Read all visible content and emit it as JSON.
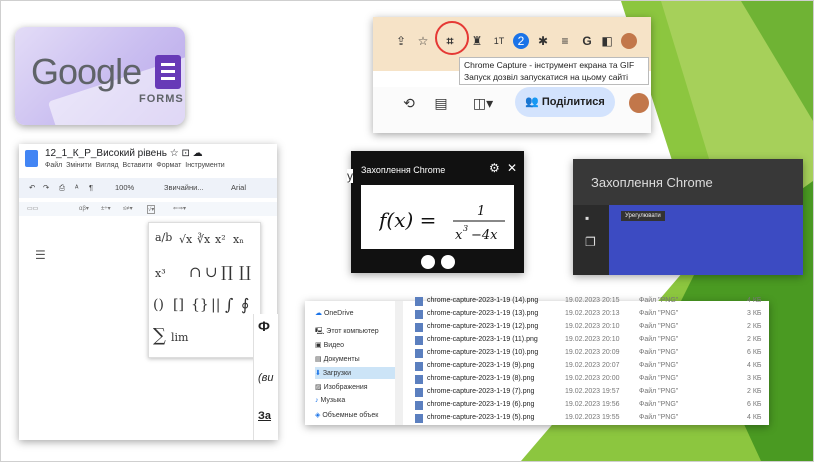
{
  "google_forms": {
    "word": "Google",
    "forms": "FORMS"
  },
  "browser": {
    "tooltip_line1": "Chrome Capture - інструмент екрана та GIF",
    "tooltip_line2": "Запуск дозвіл запускатися на цьому сайті",
    "share_label": "Поділитися"
  },
  "docs": {
    "title": "12_1_К_Р_Високий рівень",
    "menu": [
      "Файл",
      "Змінити",
      "Вигляд",
      "Вставити",
      "Формат",
      "Інструменти"
    ],
    "zoom": "100%",
    "style": "Звичайни...",
    "font": "Arial",
    "equations": [
      "a/b",
      "√x",
      "∛x",
      "x²",
      "xₙ",
      "x³",
      "∩",
      "∪",
      "∏",
      "∐",
      "()",
      "[]",
      "{}",
      "||",
      "∫",
      "∮",
      "∑",
      "lim"
    ],
    "side_text_1": "(ви",
    "side_text_2": "За"
  },
  "capture_popup": {
    "title": "Захоплення Chrome",
    "formula": "f(x) = 1 / (x³ − 4x)"
  },
  "capture_panel": {
    "title": "Захоплення Chrome",
    "tooltip": "Урегулювати"
  },
  "explorer": {
    "nav": [
      "OneDrive",
      "Этот компьютер",
      "Видео",
      "Документы",
      "Загрузки",
      "Изображения",
      "Музыка",
      "Объемные объек"
    ],
    "files": [
      {
        "name": "chrome-capture-2023-1-19 (14).png",
        "date": "19.02.2023 20:15",
        "type": "Файл \"PNG\"",
        "size": "4 КБ"
      },
      {
        "name": "chrome-capture-2023-1-19 (13).png",
        "date": "19.02.2023 20:13",
        "type": "Файл \"PNG\"",
        "size": "3 КБ"
      },
      {
        "name": "chrome-capture-2023-1-19 (12).png",
        "date": "19.02.2023 20:10",
        "type": "Файл \"PNG\"",
        "size": "2 КБ"
      },
      {
        "name": "chrome-capture-2023-1-19 (11).png",
        "date": "19.02.2023 20:10",
        "type": "Файл \"PNG\"",
        "size": "2 КБ"
      },
      {
        "name": "chrome-capture-2023-1-19 (10).png",
        "date": "19.02.2023 20:09",
        "type": "Файл \"PNG\"",
        "size": "6 КБ"
      },
      {
        "name": "chrome-capture-2023-1-19 (9).png",
        "date": "19.02.2023 20:07",
        "type": "Файл \"PNG\"",
        "size": "4 КБ"
      },
      {
        "name": "chrome-capture-2023-1-19 (8).png",
        "date": "19.02.2023 20:00",
        "type": "Файл \"PNG\"",
        "size": "3 КБ"
      },
      {
        "name": "chrome-capture-2023-1-19 (7).png",
        "date": "19.02.2023 19:57",
        "type": "Файл \"PNG\"",
        "size": "2 КБ"
      },
      {
        "name": "chrome-capture-2023-1-19 (6).png",
        "date": "19.02.2023 19:56",
        "type": "Файл \"PNG\"",
        "size": "6 КБ"
      },
      {
        "name": "chrome-capture-2023-1-19 (5).png",
        "date": "19.02.2023 19:55",
        "type": "Файл \"PNG\"",
        "size": "4 КБ"
      }
    ]
  },
  "colors": {
    "green_light": "#8cc63f",
    "green_dark": "#3f8f1d",
    "forms_purple": "#673ab7",
    "capture_blue": "#3c4bc2"
  }
}
